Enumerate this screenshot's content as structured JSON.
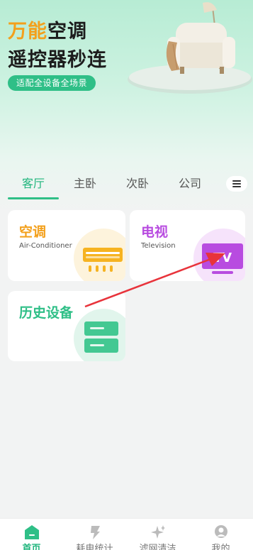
{
  "hero": {
    "title_highlight": "万能",
    "title_rest": "空调",
    "title_line2": "遥控器秒连",
    "pill": "适配全设备全场景"
  },
  "tabs": [
    "客厅",
    "主卧",
    "次卧",
    "公司"
  ],
  "active_tab": "客厅",
  "devices": [
    {
      "title": "空调",
      "subtitle": "Air-Conditioner",
      "icon": "air-conditioner-icon",
      "color": "#f3a01c"
    },
    {
      "title": "电视",
      "subtitle": "Television",
      "icon": "television-icon",
      "color": "#b84ce0"
    },
    {
      "title": "历史设备",
      "icon": "history-devices-icon",
      "color": "#2fbf87"
    }
  ],
  "bottom_nav": [
    {
      "label": "首页",
      "icon": "home-icon",
      "active": true
    },
    {
      "label": "耗电统计",
      "icon": "power-stats-icon",
      "active": false
    },
    {
      "label": "滤网清洁",
      "icon": "sparkle-clean-icon",
      "active": false
    },
    {
      "label": "我的",
      "icon": "profile-icon",
      "active": false
    }
  ],
  "colors": {
    "accent": "#2fbf87",
    "orange": "#f3a01c",
    "purple": "#b84ce0",
    "arrow": "#e8333b"
  }
}
